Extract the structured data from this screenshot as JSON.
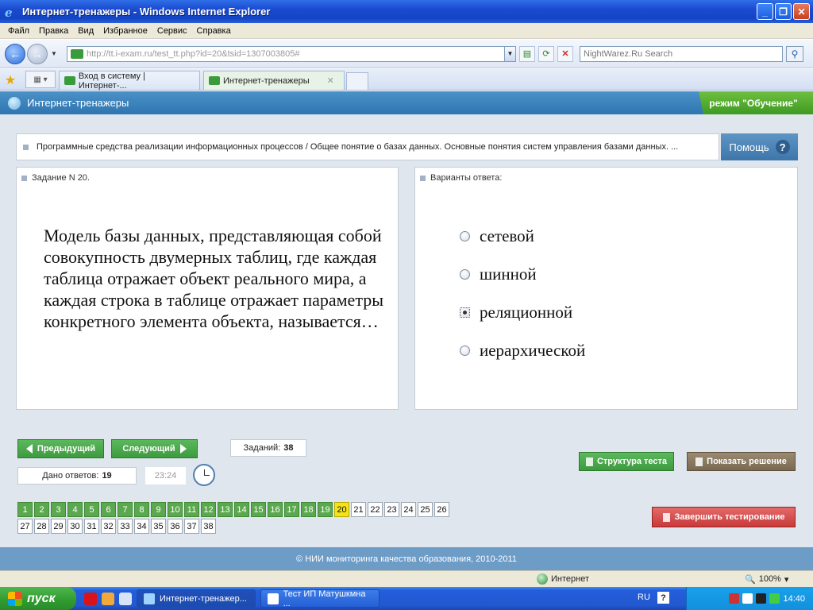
{
  "window": {
    "title": "Интернет-тренажеры - Windows Internet Explorer",
    "logo_icon": "ie-logo-icon"
  },
  "menu": [
    "Файл",
    "Правка",
    "Вид",
    "Избранное",
    "Сервис",
    "Справка"
  ],
  "address": {
    "url": "http://tt.i-exam.ru/test_tt.php?id=20&tsid=1307003805#",
    "search_placeholder": "NightWarez.Ru Search"
  },
  "tabs": [
    {
      "label": "Вход в систему | Интернет-..."
    },
    {
      "label": "Интернет-тренажеры"
    }
  ],
  "app": {
    "title": "Интернет-тренажеры",
    "mode": "режим \"Обучение\""
  },
  "breadcrumb": "Программные средства реализации информационных процессов / Общее понятие о базах данных. Основные понятия систем управления базами данных. ...",
  "help_label": "Помощь",
  "task": {
    "header": "Задание N 20.",
    "question": "Модель базы данных, представляющая собой совокупность двумерных таблиц, где каждая таблица отражает объект реального мира, а каждая строка в таблице отражает параметры конкретного элемента объекта, называется…"
  },
  "answers": {
    "header": "Варианты ответа:",
    "options": [
      "сетевой",
      "шинной",
      "реляционной",
      "иерархической"
    ],
    "selected_index": 2
  },
  "controls": {
    "prev": "Предыдущий",
    "next": "Следующий",
    "tasks_label": "Заданий:",
    "tasks_count": "38",
    "answered_label": "Дано ответов:",
    "answered_count": "19",
    "timer": "23:24",
    "structure": "Структура теста",
    "show_solution": "Показать решение",
    "finish": "Завершить тестирование"
  },
  "question_grid": {
    "row1": [
      "1",
      "2",
      "3",
      "4",
      "5",
      "6",
      "7",
      "8",
      "9",
      "10",
      "11",
      "12",
      "13",
      "14",
      "15",
      "16",
      "17",
      "18",
      "19",
      "20",
      "21",
      "22",
      "23",
      "24",
      "25",
      "26"
    ],
    "row2": [
      "27",
      "28",
      "29",
      "30",
      "31",
      "32",
      "33",
      "34",
      "35",
      "36",
      "37",
      "38"
    ],
    "answered_up_to": 19,
    "current": 20,
    "colors": {
      "answered": "#5ba84e",
      "current": "#f4e31c"
    }
  },
  "footer": "© НИИ мониторинга качества образования, 2010-2011",
  "status": {
    "zone": "Интернет",
    "zoom": "100%"
  },
  "taskbar": {
    "start": "пуск",
    "items": [
      "Интернет-тренажер...",
      "Тест ИП Матушкмна ..."
    ],
    "lang": "RU",
    "time": "14:40"
  }
}
